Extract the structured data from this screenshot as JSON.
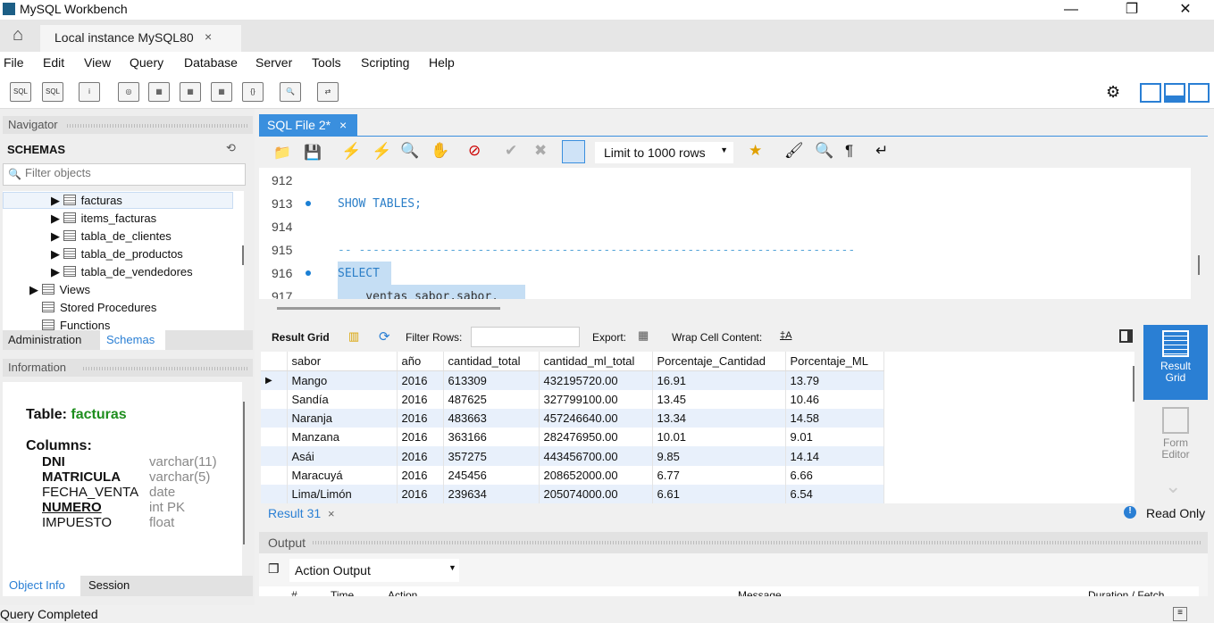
{
  "window": {
    "title": "MySQL Workbench",
    "minimize": "—",
    "restore": "❐",
    "close": "✕"
  },
  "connection_tab": {
    "label": "Local instance MySQL80",
    "close": "×"
  },
  "menu": [
    "File",
    "Edit",
    "View",
    "Query",
    "Database",
    "Server",
    "Tools",
    "Scripting",
    "Help"
  ],
  "navigator": {
    "title": "Navigator",
    "schemas_title": "SCHEMAS",
    "filter_placeholder": "Filter objects",
    "tables": [
      "facturas",
      "items_facturas",
      "tabla_de_clientes",
      "tabla_de_productos",
      "tabla_de_vendedores"
    ],
    "folders": [
      "Views",
      "Stored Procedures",
      "Functions"
    ],
    "tabs": [
      "Administration",
      "Schemas"
    ]
  },
  "information": {
    "title": "Information",
    "table_label": "Table:",
    "table_name": "facturas",
    "columns_label": "Columns:",
    "columns": [
      {
        "name": "DNI",
        "type": "varchar(11)"
      },
      {
        "name": "MATRICULA",
        "type": "varchar(5)"
      },
      {
        "name": "FECHA_VENTA",
        "type": "date"
      },
      {
        "name": "NUMERO",
        "type": "int PK"
      },
      {
        "name": "IMPUESTO",
        "type": "float"
      }
    ],
    "tabs": [
      "Object Info",
      "Session"
    ]
  },
  "sql_tab": {
    "label": "SQL File 2*",
    "close": "×"
  },
  "editor_toolbar": {
    "limit": "Limit to 1000 rows"
  },
  "editor": {
    "lines": [
      {
        "n": "912",
        "code": "",
        "dot": false
      },
      {
        "n": "913",
        "code": "SHOW TABLES;",
        "dot": true
      },
      {
        "n": "914",
        "code": "",
        "dot": false
      },
      {
        "n": "915",
        "code": "-- -----------------------------------------------------------------------",
        "dot": false
      },
      {
        "n": "916",
        "code": "SELECT",
        "dot": true
      },
      {
        "n": "917",
        "code": "    ventas_sabor.sabor,",
        "dot": false
      }
    ]
  },
  "result_toolbar": {
    "result_grid": "Result Grid",
    "filter_rows": "Filter Rows:",
    "export": "Export:",
    "wrap": "Wrap Cell Content:"
  },
  "grid": {
    "columns": [
      "sabor",
      "año",
      "cantidad_total",
      "cantidad_ml_total",
      "Porcentaje_Cantidad",
      "Porcentaje_ML"
    ],
    "rows": [
      [
        "Mango",
        "2016",
        "613309",
        "432195720.00",
        "16.91",
        "13.79"
      ],
      [
        "Sandía",
        "2016",
        "487625",
        "327799100.00",
        "13.45",
        "10.46"
      ],
      [
        "Naranja",
        "2016",
        "483663",
        "457246640.00",
        "13.34",
        "14.58"
      ],
      [
        "Manzana",
        "2016",
        "363166",
        "282476950.00",
        "10.01",
        "9.01"
      ],
      [
        "Asái",
        "2016",
        "357275",
        "443456700.00",
        "9.85",
        "14.14"
      ],
      [
        "Maracuyá",
        "2016",
        "245456",
        "208652000.00",
        "6.77",
        "6.66"
      ],
      [
        "Lima/Limón",
        "2016",
        "239634",
        "205074000.00",
        "6.61",
        "6.54"
      ]
    ]
  },
  "side_panel": {
    "result_grid": "Result Grid",
    "form_editor": "Form Editor"
  },
  "result_tab": {
    "label": "Result 31",
    "close": "×",
    "read_only": "Read Only"
  },
  "output": {
    "title": "Output",
    "selector": "Action Output",
    "columns": [
      "#",
      "Time",
      "Action",
      "Message",
      "Duration / Fetch"
    ]
  },
  "status": "Query Completed"
}
